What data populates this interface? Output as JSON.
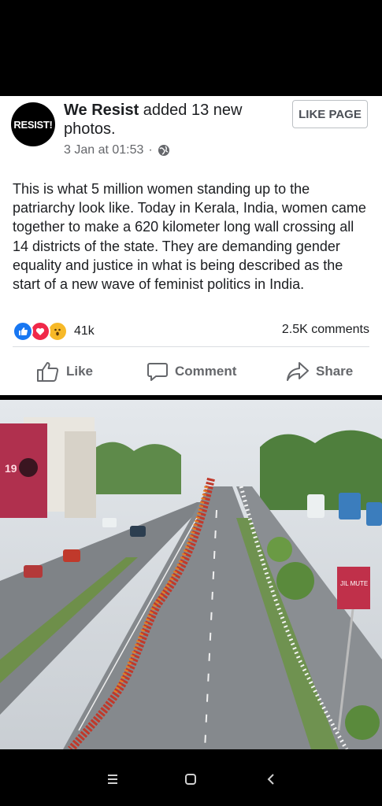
{
  "post": {
    "avatar_text": "RESIST!",
    "page_name": "We Resist",
    "action_text": " added 13 new photos.",
    "timestamp": "3 Jan at 01:53",
    "separator": "·",
    "like_page_label": "LIKE PAGE",
    "body": "This is what 5 million women standing up to the patriarchy look like. Today in Kerala, India, women came together to make a 620 kilometer long wall crossing all 14 districts of the state. They are demanding gender equality and justice in what is being described as the start of a new wave of feminist politics in India."
  },
  "stats": {
    "reaction_count": "41k",
    "comments": "2.5K comments",
    "reactions": [
      "like-icon",
      "love-icon",
      "wow-icon"
    ]
  },
  "actions": {
    "like": "Like",
    "comment": "Comment",
    "share": "Share"
  },
  "photo": {
    "billboard_text": "19",
    "sign_text": "JIL MUTE"
  },
  "colors": {
    "accent": "#1877f2",
    "love": "#f02849",
    "wow": "#f7b928",
    "text": "#1c1e21",
    "muted": "#65676b"
  },
  "navigation": {
    "buttons": [
      "recent-apps-icon",
      "home-icon",
      "back-icon"
    ]
  }
}
